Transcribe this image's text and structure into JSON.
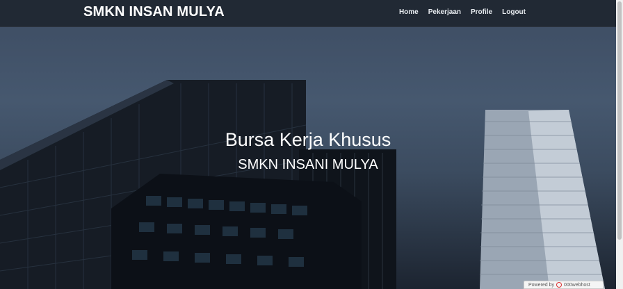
{
  "navbar": {
    "brand": "SMKN INSAN MULYA",
    "items": [
      {
        "label": "Home"
      },
      {
        "label": "Pekerjaan"
      },
      {
        "label": "Profile"
      },
      {
        "label": "Logout"
      }
    ]
  },
  "hero": {
    "title": "Bursa Kerja Khusus",
    "subtitle": "SMKN INSANI MULYA"
  },
  "badge": {
    "prefix": "Powered by",
    "brand": "000webhost"
  },
  "colors": {
    "navbar": "#1e2630",
    "sky": "#46586f",
    "text": "#ffffff"
  }
}
